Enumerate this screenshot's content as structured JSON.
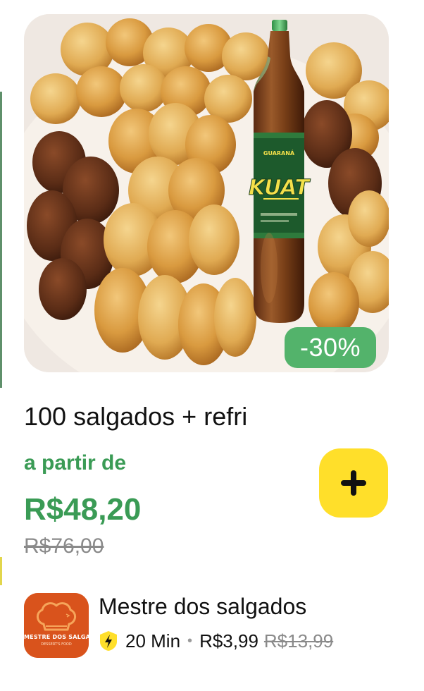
{
  "product": {
    "title": "100 salgados + refri",
    "discount_badge": "-30%",
    "from_label": "a partir de",
    "price": "R$48,20",
    "old_price": "R$76,00"
  },
  "bottle_label": {
    "brand": "KUAT",
    "subtitle": "GUARANÁ"
  },
  "store": {
    "name": "Mestre dos salgados",
    "logo_text": "MESTRE DOS SALGADOS",
    "logo_tagline": "DESSERT'S FOOD",
    "delivery_time": "20 Min",
    "delivery_fee": "R$3,99",
    "old_delivery_fee": "R$13,99"
  },
  "icons": {
    "add": "plus-icon",
    "delivery_speed": "lightning-bolt-icon",
    "logo": "chef-hat-icon"
  },
  "colors": {
    "accent_green": "#3a9b55",
    "badge_green": "#53b36b",
    "add_button_yellow": "#ffdf2a",
    "logo_orange": "#d9531c"
  }
}
